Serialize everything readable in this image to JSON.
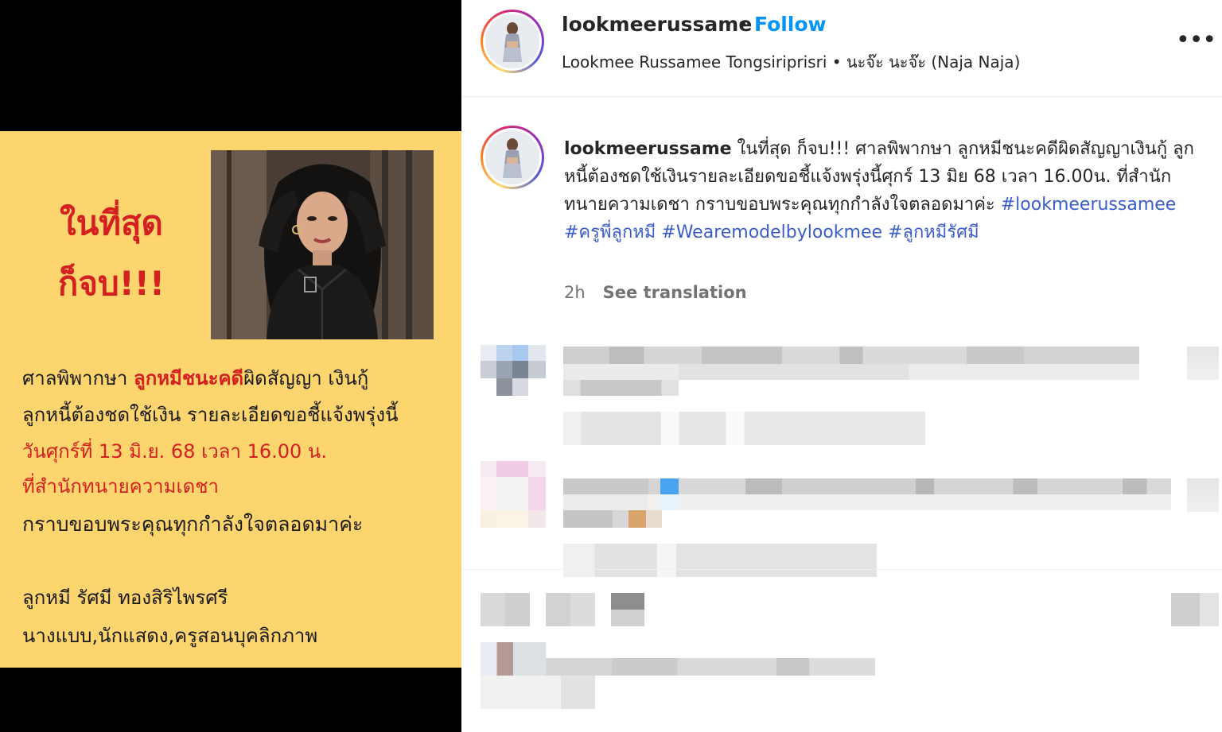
{
  "poster": {
    "headline_line1": "ในที่สุด",
    "headline_line2": "ก็จบ!!!",
    "line1_part1": "ศาลพิพากษา ",
    "line1_part2": "ลูกหมีชนะคดี",
    "line1_part3": "ผิดสัญญา เงินกู้",
    "line2": "ลูกหนี้ต้องชดใช้เงิน รายละเอียดขอชี้แจ้งพรุ่งนี้",
    "line3": "วันศุกร์ที่ 13 มิ.ย. 68 เวลา 16.00 น.",
    "line4": "ที่สำนักทนายความเดชา",
    "line5": "กราบขอบพระคุณทุกกำลังใจตลอดมาค่ะ",
    "signature_name": "ลูกหมี รัศมี ทองสิริไพรศรี",
    "signature_role": "นางแบบ,นักแสดง,ครูสอนบุคลิกภาพ",
    "colors": {
      "background": "#fdd56f",
      "accent_red": "#d42020"
    }
  },
  "header": {
    "username": "lookmeerussame",
    "separator": "•",
    "follow_label": "Follow",
    "subtitle": "Lookmee Russamee Tongsiriprisri • นะจ๊ะ นะจ๊ะ (Naja Naja)",
    "more_icon": "more-horizontal-icon",
    "more_glyph": "•••"
  },
  "caption": {
    "username": "lookmeerussame",
    "text": " ในที่สุด ก็จบ!!! ศาลพิพากษา ลูกหมีชนะคดีผิดสัญญาเงินกู้ ลูกหนี้ต้องชดใช้เงินรายละเอียดขอชี้แจ้งพรุ่งนี้ศุกร์ 13 มิย 68 เวลา 16.00น. ที่สำนักทนายความเดชา กราบขอบพระคุณทุกกำลังใจตลอดมาค่ะ ",
    "hashtags": [
      "#lookmeerussamee",
      "#ครูพี่ลูกหมี",
      "#Wearemodelbylookmee",
      "#ลูกหมีรัศมี"
    ],
    "time_ago": "2h",
    "translate_label": "See translation"
  },
  "colors": {
    "follow": "#0095f6",
    "hashtag": "#3b5ccc",
    "muted": "#737373"
  }
}
